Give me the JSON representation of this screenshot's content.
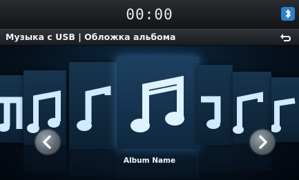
{
  "status": {
    "clock": "00:00"
  },
  "header": {
    "title": "Музыка с USB | Обложка альбома"
  },
  "now_playing": {
    "album_name": "Album Name"
  },
  "icons": {
    "bluetooth": "bluetooth-icon",
    "back": "back-arrow-icon",
    "previous": "chevron-left-icon",
    "next": "chevron-right-icon",
    "artwork": "music-note-icon"
  },
  "colors": {
    "accent": "#2f7fc8",
    "note": "#cfe9ff"
  }
}
